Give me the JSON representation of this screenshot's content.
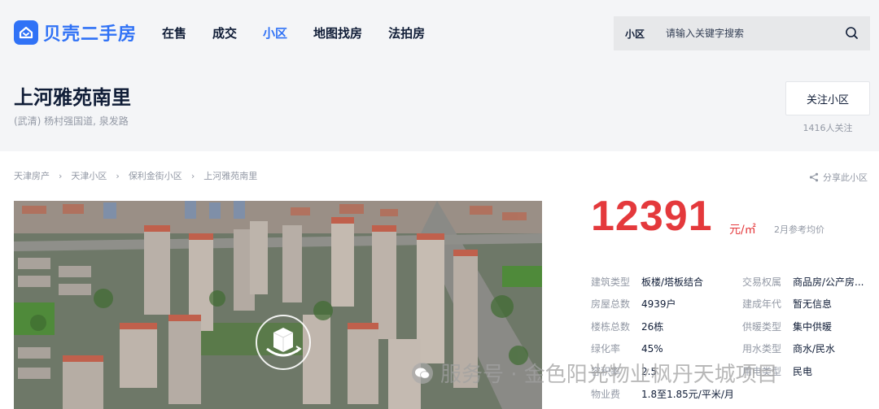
{
  "brand": {
    "name": "贝壳二手房",
    "color": "#3072f6"
  },
  "nav": [
    {
      "label": "在售"
    },
    {
      "label": "成交"
    },
    {
      "label": "小区"
    },
    {
      "label": "地图找房"
    },
    {
      "label": "法拍房"
    }
  ],
  "search": {
    "scope": "小区",
    "placeholder": "请输入关键字搜索"
  },
  "community": {
    "name": "上河雅苑南里",
    "address": "(武清) 杨村强国道, 泉发路",
    "follow_label": "关注小区",
    "follow_count": "1416人关注"
  },
  "breadcrumb": [
    "天津房产",
    "天津小区",
    "保利金街小区",
    "上河雅苑南里"
  ],
  "share_label": "分享此小区",
  "price": {
    "value": "12391",
    "unit": "元/㎡",
    "note": "2月参考均价",
    "color": "#e4393c"
  },
  "info": {
    "building_type": {
      "label": "建筑类型",
      "value": "板楼/塔板结合"
    },
    "ownership": {
      "label": "交易权属",
      "value": "商品房/公产房..."
    },
    "households": {
      "label": "房屋总数",
      "value": "4939户"
    },
    "year_built": {
      "label": "建成年代",
      "value": "暂无信息"
    },
    "buildings": {
      "label": "楼栋总数",
      "value": "26栋"
    },
    "heating": {
      "label": "供暖类型",
      "value": "集中供暖"
    },
    "green_rate": {
      "label": "绿化率",
      "value": "45%"
    },
    "water": {
      "label": "用水类型",
      "value": "商水/民水"
    },
    "plot_ratio": {
      "label": "容积率",
      "value": "2.5"
    },
    "power": {
      "label": "用电类型",
      "value": "民电"
    },
    "property_fee": {
      "label": "物业费",
      "value": "1.8至1.85元/平米/月"
    }
  },
  "watermark": "服务号 · 金色阳光物业枫丹天城项目"
}
